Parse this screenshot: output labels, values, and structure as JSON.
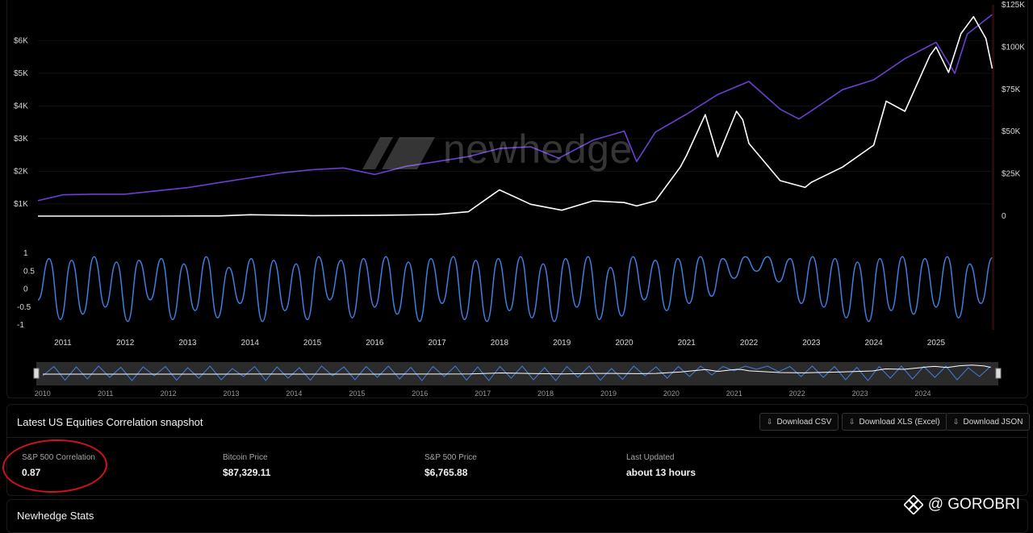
{
  "chart_data": [
    {
      "type": "line",
      "series": [
        {
          "color": "#6b3fd4",
          "axis": "left",
          "x": [
            2010.6,
            2011.0,
            2011.5,
            2012.0,
            2012.5,
            2013.0,
            2013.5,
            2014.0,
            2014.5,
            2015.0,
            2015.5,
            2016.0,
            2016.5,
            2017.0,
            2017.5,
            2018.0,
            2018.5,
            2018.95,
            2019.5,
            2020.0,
            2020.2,
            2020.5,
            2021.0,
            2021.5,
            2022.0,
            2022.5,
            2022.8,
            2023.0,
            2023.5,
            2024.0,
            2024.5,
            2025.0,
            2025.3,
            2025.5,
            2025.9
          ],
          "y": [
            1100,
            1280,
            1300,
            1300,
            1400,
            1500,
            1650,
            1800,
            1950,
            2050,
            2100,
            1900,
            2150,
            2300,
            2450,
            2700,
            2750,
            2400,
            2950,
            3230,
            2300,
            3200,
            3750,
            4350,
            4750,
            3900,
            3600,
            3850,
            4500,
            4800,
            5450,
            5950,
            5000,
            6200,
            6800
          ]
        },
        {
          "color": "#ffffff",
          "axis": "right",
          "x": [
            2010.6,
            2011.5,
            2012.5,
            2013.5,
            2014.0,
            2015.0,
            2016.0,
            2016.5,
            2017.0,
            2017.5,
            2017.9,
            2018.0,
            2018.5,
            2019.0,
            2019.5,
            2020.0,
            2020.2,
            2020.5,
            2020.9,
            2021.0,
            2021.3,
            2021.5,
            2021.8,
            2021.9,
            2022.0,
            2022.5,
            2022.9,
            2023.0,
            2023.5,
            2024.0,
            2024.2,
            2024.5,
            2024.9,
            2025.0,
            2025.2,
            2025.4,
            2025.6,
            2025.8,
            2025.9
          ],
          "y": [
            0,
            10,
            13,
            100,
            800,
            300,
            430,
            650,
            1000,
            2600,
            13000,
            15500,
            7000,
            3500,
            9000,
            8000,
            6000,
            9000,
            29000,
            36000,
            60000,
            35000,
            62000,
            57000,
            43000,
            21000,
            17000,
            20000,
            29000,
            42000,
            68000,
            62000,
            95000,
            100000,
            85000,
            108000,
            118000,
            105000,
            87329
          ]
        }
      ],
      "y_left_ticks": [
        "$1K",
        "$2K",
        "$3K",
        "$4K",
        "$5K",
        "$6K"
      ],
      "y_right_ticks": [
        "0",
        "$25K",
        "$50K",
        "$75K",
        "$100K",
        "$125K"
      ],
      "ylim_left": [
        800,
        6800
      ],
      "ylim_right": [
        0,
        125000
      ]
    },
    {
      "type": "line",
      "series": [
        {
          "color": "#3f7fe0",
          "x": [
            2010.6,
            2010.78,
            2010.96,
            2011.14,
            2011.32,
            2011.5,
            2011.68,
            2011.86,
            2012.04,
            2012.22,
            2012.4,
            2012.58,
            2012.76,
            2012.94,
            2013.12,
            2013.3,
            2013.48,
            2013.66,
            2013.84,
            2014.02,
            2014.2,
            2014.38,
            2014.56,
            2014.74,
            2014.92,
            2015.1,
            2015.28,
            2015.46,
            2015.64,
            2015.82,
            2016.0,
            2016.18,
            2016.36,
            2016.54,
            2016.72,
            2016.9,
            2017.08,
            2017.26,
            2017.44,
            2017.62,
            2017.8,
            2017.98,
            2018.16,
            2018.34,
            2018.52,
            2018.7,
            2018.88,
            2019.06,
            2019.24,
            2019.42,
            2019.6,
            2019.78,
            2019.96,
            2020.14,
            2020.32,
            2020.5,
            2020.68,
            2020.86,
            2021.04,
            2021.22,
            2021.4,
            2021.58,
            2021.76,
            2021.94,
            2022.12,
            2022.3,
            2022.48,
            2022.66,
            2022.84,
            2023.02,
            2023.2,
            2023.38,
            2023.56,
            2023.74,
            2023.92,
            2024.1,
            2024.28,
            2024.46,
            2024.64,
            2024.82,
            2025.0,
            2025.18,
            2025.36,
            2025.54,
            2025.72,
            2025.9
          ],
          "y": [
            -0.3,
            0.85,
            -0.85,
            0.8,
            -0.7,
            0.9,
            -0.5,
            0.75,
            -0.9,
            0.8,
            -0.3,
            0.85,
            -0.85,
            0.7,
            -0.6,
            0.9,
            -0.8,
            0.6,
            -0.4,
            0.85,
            -0.9,
            0.8,
            -0.6,
            0.7,
            -0.85,
            0.9,
            -0.3,
            0.8,
            -0.8,
            0.85,
            -0.5,
            0.9,
            -0.7,
            0.75,
            -0.9,
            0.85,
            -0.4,
            0.9,
            -0.85,
            0.8,
            -0.9,
            0.85,
            -0.6,
            0.9,
            -0.8,
            0.7,
            -0.9,
            0.85,
            -0.5,
            0.9,
            -0.85,
            0.6,
            -0.75,
            0.9,
            -0.3,
            0.8,
            -0.6,
            0.85,
            -0.4,
            0.9,
            -0.2,
            0.85,
            0.3,
            0.9,
            0.5,
            0.9,
            0.2,
            0.85,
            -0.4,
            0.9,
            -0.5,
            0.85,
            -0.8,
            0.75,
            -0.9,
            0.85,
            -0.6,
            0.9,
            -0.7,
            0.85,
            -0.5,
            0.9,
            -0.8,
            0.7,
            -0.4,
            0.87
          ]
        }
      ],
      "y_ticks": [
        "1",
        "0.5",
        "0",
        "-0.5",
        "-1"
      ],
      "ylim": [
        -1,
        1
      ],
      "x_ticks": [
        "2011",
        "2012",
        "2013",
        "2014",
        "2015",
        "2016",
        "2017",
        "2018",
        "2019",
        "2020",
        "2021",
        "2022",
        "2023",
        "2024",
        "2025"
      ]
    },
    {
      "type": "line",
      "x_ticks": [
        "2010",
        "2011",
        "2012",
        "2013",
        "2014",
        "2015",
        "2016",
        "2017",
        "2018",
        "2019",
        "2020",
        "2021",
        "2022",
        "2023",
        "2024"
      ]
    }
  ],
  "watermark": "newhedge",
  "snapshot": {
    "title": "Latest US Equities Correlation snapshot",
    "buttons": [
      "Download CSV",
      "Download XLS (Excel)",
      "Download JSON"
    ],
    "stats": [
      {
        "label": "S&P 500 Correlation",
        "value": "0.87"
      },
      {
        "label": "Bitcoin Price",
        "value": "$87,329.11"
      },
      {
        "label": "S&P 500 Price",
        "value": "$6,765.88"
      },
      {
        "label": "Last Updated",
        "value": "about 13 hours"
      }
    ]
  },
  "stats_section": {
    "title": "Newhedge Stats"
  },
  "credit": {
    "text": "@ GOROBRI"
  }
}
